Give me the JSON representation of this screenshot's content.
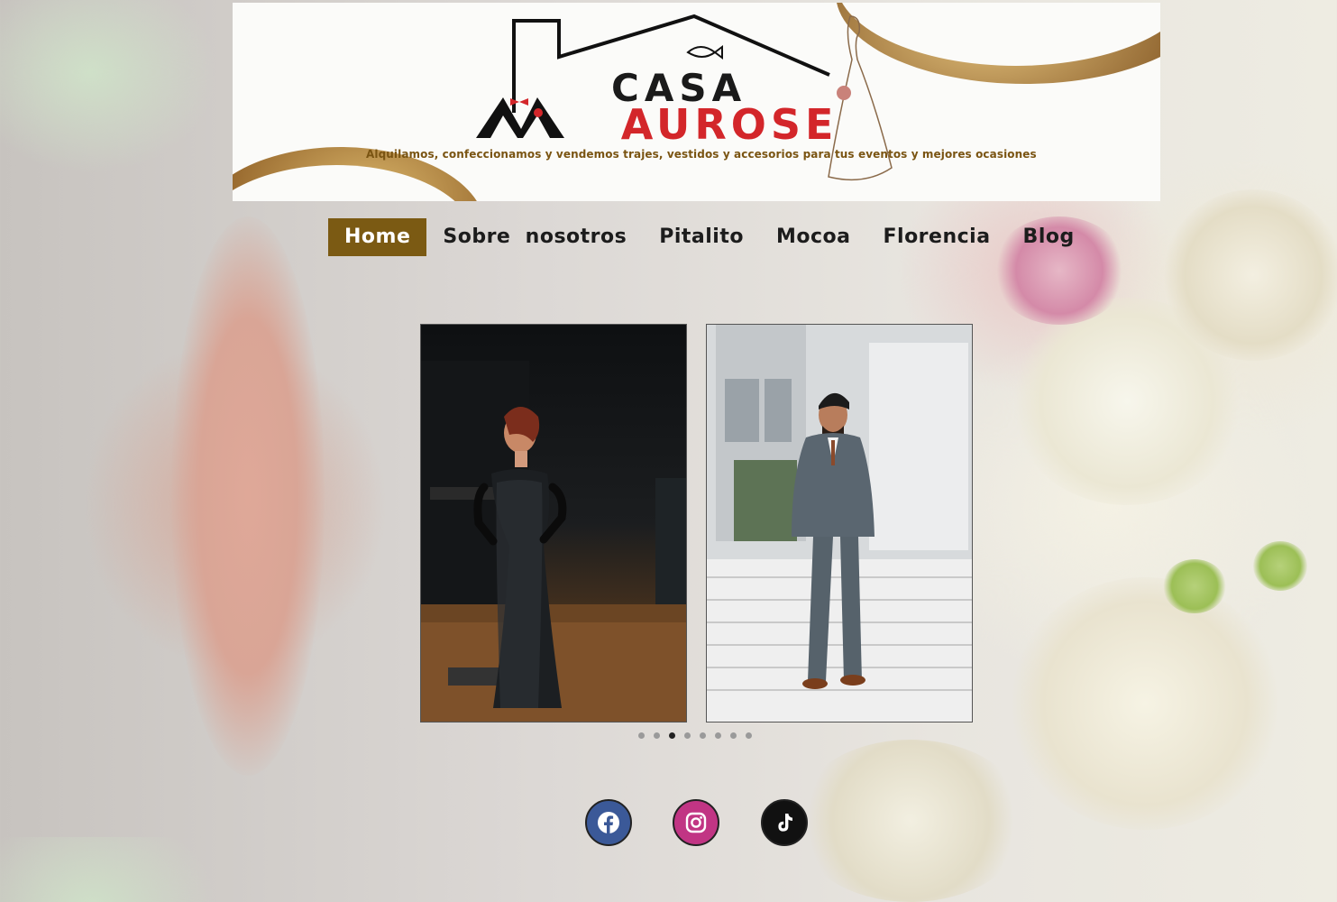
{
  "header": {
    "logo_casa": "CASA",
    "logo_m": "M",
    "logo_rest": "AUROSE",
    "tagline": "Alquilamos, confeccionamos y vendemos trajes, vestidos y accesorios para tus eventos y mejores ocasiones"
  },
  "nav": {
    "items": [
      {
        "label": "Home",
        "active": true
      },
      {
        "label": "Sobre  nosotros"
      },
      {
        "label": "Pitalito"
      },
      {
        "label": "Mocoa"
      },
      {
        "label": "Florencia"
      },
      {
        "label": "Blog"
      }
    ]
  },
  "carousel": {
    "slides": [
      "woman-black-sequin-gown-photo",
      "man-grey-checked-suit-photo"
    ],
    "dot_count": 8,
    "active_dot": 3
  },
  "social": [
    "facebook-icon",
    "instagram-icon",
    "tiktok-icon"
  ],
  "colors": {
    "nav_active_bg": "#7b5a13",
    "brand_red": "#d3262a",
    "tagline_gold": "#7a5412"
  }
}
